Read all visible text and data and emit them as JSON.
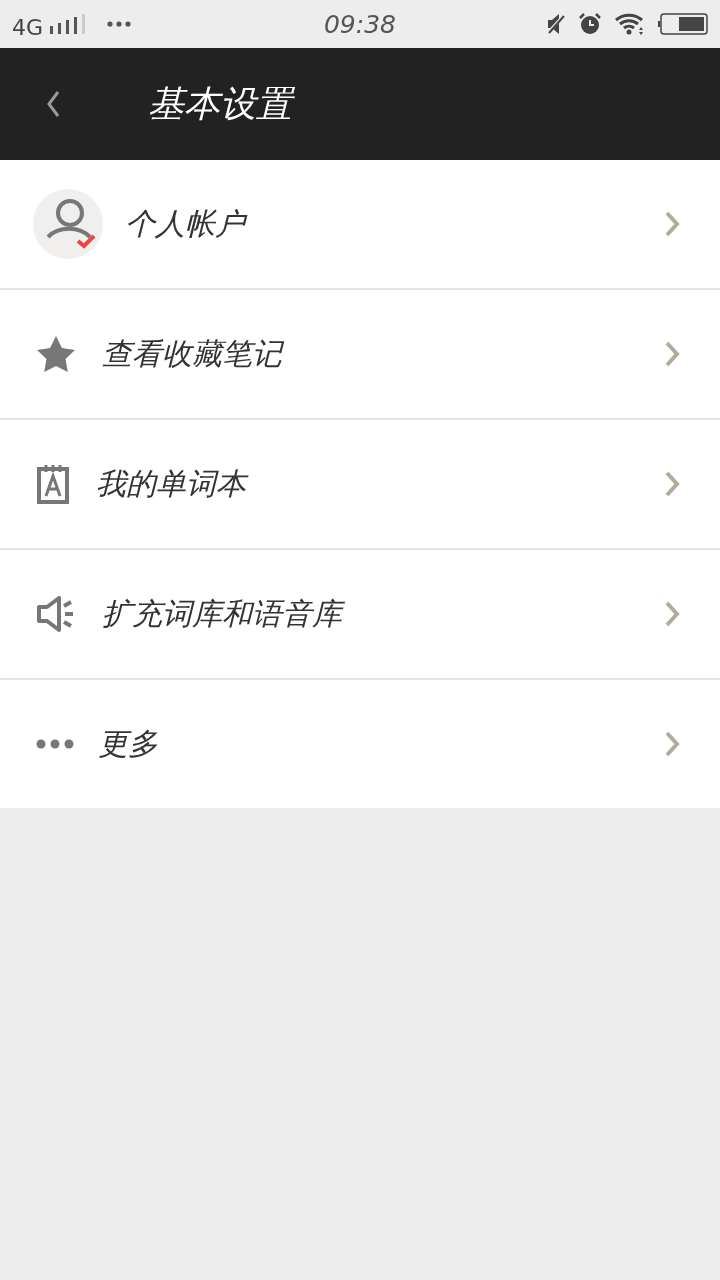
{
  "status_bar": {
    "network": "4G",
    "time": "09:38"
  },
  "header": {
    "title": "基本设置"
  },
  "menu": [
    {
      "kind": "account",
      "label": "个人帐户"
    },
    {
      "kind": "star",
      "label": "查看收藏笔记"
    },
    {
      "kind": "wordbook",
      "label": "我的单词本"
    },
    {
      "kind": "speaker",
      "label": "扩充词库和语音库"
    },
    {
      "kind": "more",
      "label": "更多"
    }
  ]
}
